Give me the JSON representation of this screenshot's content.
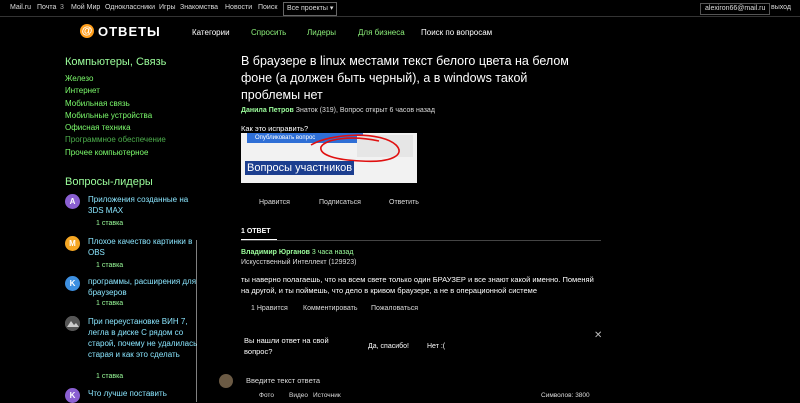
{
  "topbar": {
    "links": [
      "Mail.ru",
      "Почта",
      "Мой Мир",
      "Одноклассники",
      "Игры",
      "Знакомства",
      "Новости",
      "Поиск"
    ],
    "mail_count": "3",
    "all_projects": "Все проекты",
    "user_email": "alexiron66@mail.ru",
    "exit": "выход"
  },
  "header": {
    "logo_text": "ОТВЕТЫ",
    "nav": [
      "Категории",
      "Спросить",
      "Лидеры",
      "Для бизнеса",
      "Поиск по вопросам"
    ]
  },
  "sidebar": {
    "category_title": "Компьютеры, Связь",
    "subcategories": [
      "Железо",
      "Интернет",
      "Мобильная связь",
      "Мобильные устройства",
      "Офисная техника",
      "Программное обеспечение",
      "Прочее компьютерное"
    ],
    "leaders_title": "Вопросы-лидеры",
    "leader_questions": [
      {
        "avatar": "A",
        "color": "#8a5fd1",
        "text": "Приложения созданные на 3DS MAX",
        "stake": "1 ставка"
      },
      {
        "avatar": "M",
        "color": "#f5a623",
        "text": "Плохое качество картинки в OBS",
        "stake": "1 ставка"
      },
      {
        "avatar": "K",
        "color": "#3d8fe0",
        "text": "программы, расширения для браузеров",
        "stake": "1 ставка"
      },
      {
        "avatar": "",
        "color": "#6a6a6a",
        "text": "При переустановке ВИН 7, легла в диске С рядом со старой, почему не удалилась старая и как это сделать",
        "stake": "1 ставка"
      },
      {
        "avatar": "K",
        "color": "#8a5fd1",
        "text": "Что лучше поставить",
        "stake": ""
      }
    ]
  },
  "question": {
    "title": "В браузере в linux местами текст белого цвета на белом фоне (а должен быть черный), а в windows такой проблемы нет",
    "author": "Данила Петров",
    "author_meta": "Знаток (319), Вопрос открыт 6 часов назад",
    "body": "Как это исправить?",
    "image_button_text": "Опубликовать вопрос",
    "image_selected_text": "Вопросы участников",
    "actions": [
      "Нравится",
      "Подписаться",
      "Ответить"
    ]
  },
  "answers": {
    "tab_label": "1 ОТВЕТ",
    "items": [
      {
        "author": "Владимир Юрганов",
        "time": "3 часа назад",
        "rank": "Искусственный Интеллект (129923)",
        "text": "ты наверно полагаешь, что на всем свете только один БРАУЗЕР и все знают какой именно. Поменяй на другой, и ты поймешь, что дело в кривом браузере, а не в операционной системе",
        "actions": [
          "Нравится",
          "Комментировать",
          "Пожаловаться"
        ]
      }
    ]
  },
  "found_answer": {
    "question": "Вы нашли ответ на свой вопрос?",
    "yes": "Да, спасибо!",
    "no": "Нет :("
  },
  "compose": {
    "placeholder": "Введите текст ответа",
    "tools": [
      "Фото",
      "Видео",
      "Источник"
    ],
    "counter": "Символов: 3800"
  }
}
